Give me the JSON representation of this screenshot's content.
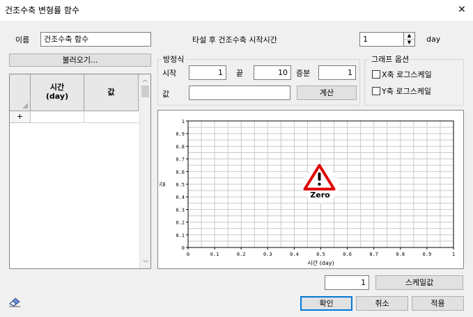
{
  "window": {
    "title": "건조수축 변형률 함수",
    "close_glyph": "✕"
  },
  "name": {
    "label": "이름",
    "value": "건조수축 함수"
  },
  "start_time": {
    "label": "타설 후 건조수축 시작시간",
    "value": "1",
    "unit": "day"
  },
  "load_button": "불러오기...",
  "table": {
    "col_time": "시간\n(day)",
    "col_value": "값",
    "add_row": "+"
  },
  "equation": {
    "title": "방정식",
    "start_label": "시작",
    "start_value": "1",
    "end_label": "끝",
    "end_value": "10",
    "step_label": "증분",
    "step_value": "1",
    "value_label": "값",
    "value_input": "",
    "calc_button": "계산"
  },
  "graph_options": {
    "title": "그래프 옵션",
    "x_log": "X축 로그스케일",
    "y_log": "Y축 로그스케일"
  },
  "chart_data": {
    "type": "line",
    "series": [],
    "xlabel": "시간 (day)",
    "ylabel": "값",
    "xlim": [
      0,
      1
    ],
    "ylim": [
      0,
      1
    ],
    "xticks": [
      "0",
      "0.1",
      "0.2",
      "0.3",
      "0.4",
      "0.5",
      "0.6",
      "0.7",
      "0.8",
      "0.9",
      "1"
    ],
    "yticks": [
      "0",
      "0.1",
      "0.2",
      "0.3",
      "0.4",
      "0.5",
      "0.6",
      "0.7",
      "0.8",
      "0.9",
      "1"
    ],
    "grid": true,
    "annotation": "Zero"
  },
  "scale": {
    "value": "1",
    "button": "스케일값"
  },
  "buttons": {
    "ok": "확인",
    "cancel": "취소",
    "apply": "적용"
  },
  "colors": {
    "accent": "#0078d7",
    "warning": "#e00000"
  }
}
